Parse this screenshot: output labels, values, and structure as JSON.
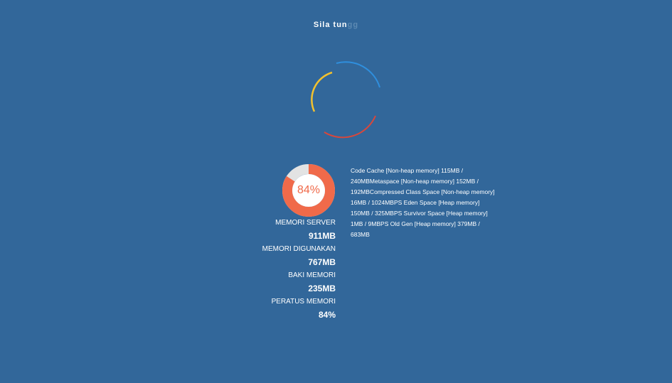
{
  "loading": {
    "title_visible": "Sila tun",
    "title_faded": "gg"
  },
  "colors": {
    "background": "#32679a",
    "spinner_blue": "#2f8fde",
    "spinner_yellow": "#f2c12e",
    "spinner_red": "#d9473b",
    "donut_used": "#f06a4a",
    "donut_track": "#e3e3e3"
  },
  "memory": {
    "donut_percent_value": 0.84,
    "donut_label": "84%",
    "server_label": "MEMORI SERVER",
    "server_value": "911MB",
    "used_label": "MEMORI DIGUNAKAN",
    "used_value": "767MB",
    "free_label": "BAKI MEMORI",
    "free_value": "235MB",
    "percent_label": "PERATUS MEMORI",
    "percent_value": "84%"
  },
  "pools": {
    "text": "Code Cache [Non-heap memory] 115MB / 240MBMetaspace [Non-heap memory] 152MB / 192MBCompressed Class Space [Non-heap memory] 16MB / 1024MBPS Eden Space [Heap memory] 150MB / 325MBPS Survivor Space [Heap memory] 1MB / 9MBPS Old Gen [Heap memory] 379MB / 683MB"
  }
}
